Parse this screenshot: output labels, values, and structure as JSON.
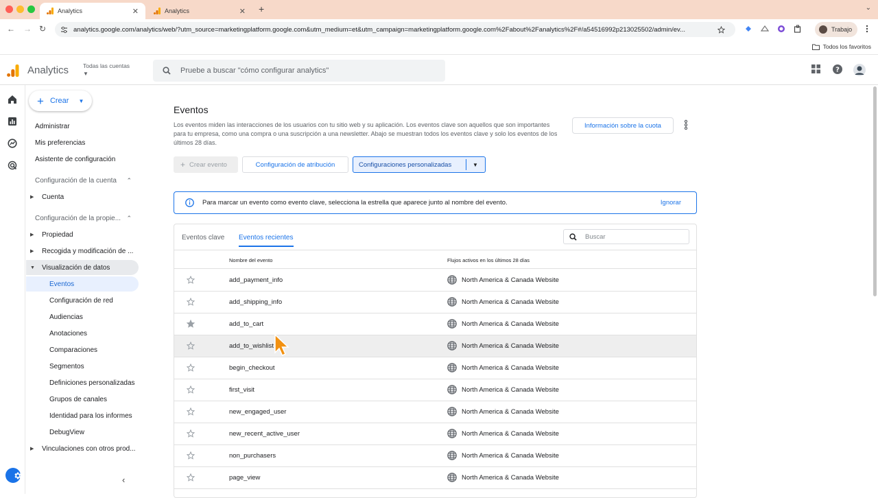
{
  "browser": {
    "tabs": [
      {
        "title": "Analytics",
        "active": true
      },
      {
        "title": "Analytics",
        "active": false
      }
    ],
    "url": "analytics.google.com/analytics/web/?utm_source=marketingplatform.google.com&utm_medium=et&utm_campaign=marketingplatform.google.com%2Fabout%2Fanalytics%2F#/a54516992p213025502/admin/ev...",
    "profile": "Trabajo",
    "bookmarks_all": "Todos los favoritos",
    "colors": {
      "tab_bar": "#f7d9c9",
      "accent": "#1a73e8"
    }
  },
  "header": {
    "app_name": "Analytics",
    "account_label": "Todas las cuentas",
    "search_placeholder": "Pruebe a buscar \"cómo configurar analytics\""
  },
  "sidenav": {
    "create_label": "Crear",
    "top_items": [
      "Administrar",
      "Mis preferencias",
      "Asistente de configuración"
    ],
    "account_section": "Configuración de la cuenta",
    "account_items": [
      "Cuenta"
    ],
    "property_section": "Configuración de la propie...",
    "property_items": [
      "Propiedad",
      "Recogida y modificación de ...",
      "Visualización de datos"
    ],
    "data_display_items": [
      "Eventos",
      "Configuración de red",
      "Audiencias",
      "Anotaciones",
      "Comparaciones",
      "Segmentos",
      "Definiciones personalizadas",
      "Grupos de canales",
      "Identidad para los informes",
      "DebugView"
    ],
    "links_item": "Vinculaciones con otros prod..."
  },
  "main": {
    "title": "Eventos",
    "description": "Los eventos miden las interacciones de los usuarios con tu sitio web y su aplicación. Los eventos clave son aquellos que son importantes para tu empresa, como una compra o una suscripción a una newsletter. Abajo se muestran todos los eventos clave y solo los eventos de los últimos 28 días.",
    "quota_button": "Información sobre la cuota",
    "create_event": "Crear evento",
    "attribution_button": "Configuración de atribución",
    "custom_button": "Configuraciones personalizadas",
    "banner_text": "Para marcar un evento como evento clave, selecciona la estrella que aparece junto al nombre del evento.",
    "banner_ignore": "Ignorar",
    "tabs": [
      "Eventos clave",
      "Eventos recientes"
    ],
    "search_placeholder": "Buscar",
    "columns": [
      "Nombre del evento",
      "Flujos activos en los últimos 28 días"
    ],
    "rows": [
      {
        "name": "add_payment_info",
        "stream": "North America & Canada Website",
        "key": false
      },
      {
        "name": "add_shipping_info",
        "stream": "North America & Canada Website",
        "key": false
      },
      {
        "name": "add_to_cart",
        "stream": "North America & Canada Website",
        "key": true
      },
      {
        "name": "add_to_wishlist",
        "stream": "North America & Canada Website",
        "key": false
      },
      {
        "name": "begin_checkout",
        "stream": "North America & Canada Website",
        "key": false
      },
      {
        "name": "first_visit",
        "stream": "North America & Canada Website",
        "key": false
      },
      {
        "name": "new_engaged_user",
        "stream": "North America & Canada Website",
        "key": false
      },
      {
        "name": "new_recent_active_user",
        "stream": "North America & Canada Website",
        "key": false
      },
      {
        "name": "non_purchasers",
        "stream": "North America & Canada Website",
        "key": false
      },
      {
        "name": "page_view",
        "stream": "North America & Canada Website",
        "key": false
      }
    ]
  }
}
